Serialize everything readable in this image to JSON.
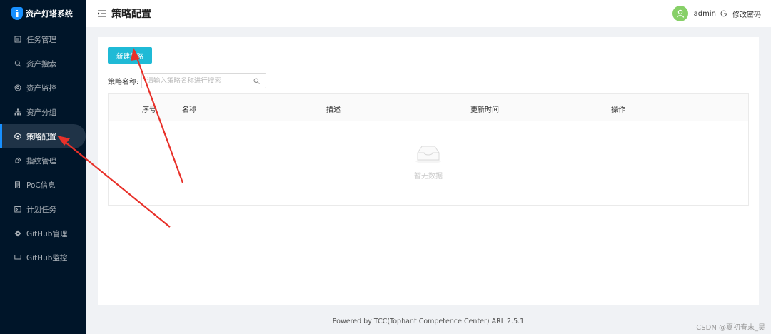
{
  "app": {
    "title": "资产灯塔系统"
  },
  "sidebar": {
    "items": [
      {
        "label": "任务管理",
        "icon": "task-icon"
      },
      {
        "label": "资产搜索",
        "icon": "search-icon"
      },
      {
        "label": "资产监控",
        "icon": "monitor-icon"
      },
      {
        "label": "资产分组",
        "icon": "group-icon"
      },
      {
        "label": "策略配置",
        "icon": "policy-icon",
        "active": true
      },
      {
        "label": "指纹管理",
        "icon": "fingerprint-icon"
      },
      {
        "label": "PoC信息",
        "icon": "poc-icon"
      },
      {
        "label": "计划任务",
        "icon": "schedule-icon"
      },
      {
        "label": "GitHub管理",
        "icon": "github-icon"
      },
      {
        "label": "GitHub监控",
        "icon": "github-monitor-icon"
      }
    ]
  },
  "header": {
    "title": "策略配置",
    "username": "admin",
    "change_password": "修改密码"
  },
  "main": {
    "new_button": "新建策略",
    "search_label": "策略名称:",
    "search_placeholder": "请输入策略名称进行搜索",
    "columns": [
      "序号",
      "名称",
      "描述",
      "更新时间",
      "操作"
    ],
    "empty_text": "暂无数据"
  },
  "footer": {
    "text": "Powered by TCC(Tophant Competence Center) ARL 2.5.1"
  },
  "watermark": "CSDN @夏初春末_昊",
  "colors": {
    "sidebar": "#001529",
    "primary": "#1fbad6",
    "annotation": "#e8312a",
    "avatar": "#87d068"
  }
}
